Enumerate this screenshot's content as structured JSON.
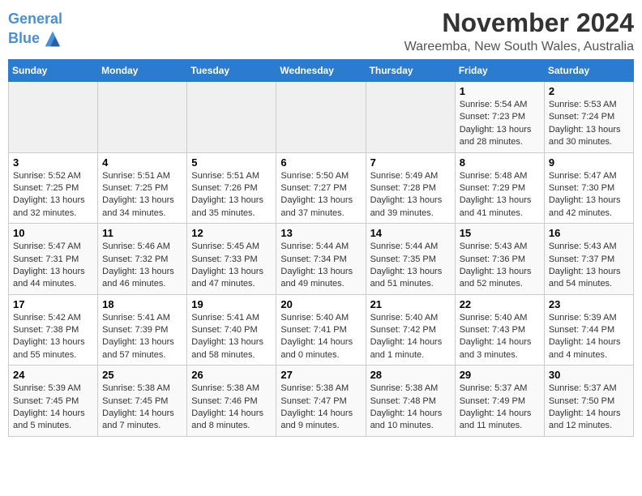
{
  "header": {
    "logo_line1": "General",
    "logo_line2": "Blue",
    "title": "November 2024",
    "subtitle": "Wareemba, New South Wales, Australia"
  },
  "days_of_week": [
    "Sunday",
    "Monday",
    "Tuesday",
    "Wednesday",
    "Thursday",
    "Friday",
    "Saturday"
  ],
  "weeks": [
    [
      {
        "day": "",
        "info": ""
      },
      {
        "day": "",
        "info": ""
      },
      {
        "day": "",
        "info": ""
      },
      {
        "day": "",
        "info": ""
      },
      {
        "day": "",
        "info": ""
      },
      {
        "day": "1",
        "info": "Sunrise: 5:54 AM\nSunset: 7:23 PM\nDaylight: 13 hours and 28 minutes."
      },
      {
        "day": "2",
        "info": "Sunrise: 5:53 AM\nSunset: 7:24 PM\nDaylight: 13 hours and 30 minutes."
      }
    ],
    [
      {
        "day": "3",
        "info": "Sunrise: 5:52 AM\nSunset: 7:25 PM\nDaylight: 13 hours and 32 minutes."
      },
      {
        "day": "4",
        "info": "Sunrise: 5:51 AM\nSunset: 7:25 PM\nDaylight: 13 hours and 34 minutes."
      },
      {
        "day": "5",
        "info": "Sunrise: 5:51 AM\nSunset: 7:26 PM\nDaylight: 13 hours and 35 minutes."
      },
      {
        "day": "6",
        "info": "Sunrise: 5:50 AM\nSunset: 7:27 PM\nDaylight: 13 hours and 37 minutes."
      },
      {
        "day": "7",
        "info": "Sunrise: 5:49 AM\nSunset: 7:28 PM\nDaylight: 13 hours and 39 minutes."
      },
      {
        "day": "8",
        "info": "Sunrise: 5:48 AM\nSunset: 7:29 PM\nDaylight: 13 hours and 41 minutes."
      },
      {
        "day": "9",
        "info": "Sunrise: 5:47 AM\nSunset: 7:30 PM\nDaylight: 13 hours and 42 minutes."
      }
    ],
    [
      {
        "day": "10",
        "info": "Sunrise: 5:47 AM\nSunset: 7:31 PM\nDaylight: 13 hours and 44 minutes."
      },
      {
        "day": "11",
        "info": "Sunrise: 5:46 AM\nSunset: 7:32 PM\nDaylight: 13 hours and 46 minutes."
      },
      {
        "day": "12",
        "info": "Sunrise: 5:45 AM\nSunset: 7:33 PM\nDaylight: 13 hours and 47 minutes."
      },
      {
        "day": "13",
        "info": "Sunrise: 5:44 AM\nSunset: 7:34 PM\nDaylight: 13 hours and 49 minutes."
      },
      {
        "day": "14",
        "info": "Sunrise: 5:44 AM\nSunset: 7:35 PM\nDaylight: 13 hours and 51 minutes."
      },
      {
        "day": "15",
        "info": "Sunrise: 5:43 AM\nSunset: 7:36 PM\nDaylight: 13 hours and 52 minutes."
      },
      {
        "day": "16",
        "info": "Sunrise: 5:43 AM\nSunset: 7:37 PM\nDaylight: 13 hours and 54 minutes."
      }
    ],
    [
      {
        "day": "17",
        "info": "Sunrise: 5:42 AM\nSunset: 7:38 PM\nDaylight: 13 hours and 55 minutes."
      },
      {
        "day": "18",
        "info": "Sunrise: 5:41 AM\nSunset: 7:39 PM\nDaylight: 13 hours and 57 minutes."
      },
      {
        "day": "19",
        "info": "Sunrise: 5:41 AM\nSunset: 7:40 PM\nDaylight: 13 hours and 58 minutes."
      },
      {
        "day": "20",
        "info": "Sunrise: 5:40 AM\nSunset: 7:41 PM\nDaylight: 14 hours and 0 minutes."
      },
      {
        "day": "21",
        "info": "Sunrise: 5:40 AM\nSunset: 7:42 PM\nDaylight: 14 hours and 1 minute."
      },
      {
        "day": "22",
        "info": "Sunrise: 5:40 AM\nSunset: 7:43 PM\nDaylight: 14 hours and 3 minutes."
      },
      {
        "day": "23",
        "info": "Sunrise: 5:39 AM\nSunset: 7:44 PM\nDaylight: 14 hours and 4 minutes."
      }
    ],
    [
      {
        "day": "24",
        "info": "Sunrise: 5:39 AM\nSunset: 7:45 PM\nDaylight: 14 hours and 5 minutes."
      },
      {
        "day": "25",
        "info": "Sunrise: 5:38 AM\nSunset: 7:45 PM\nDaylight: 14 hours and 7 minutes."
      },
      {
        "day": "26",
        "info": "Sunrise: 5:38 AM\nSunset: 7:46 PM\nDaylight: 14 hours and 8 minutes."
      },
      {
        "day": "27",
        "info": "Sunrise: 5:38 AM\nSunset: 7:47 PM\nDaylight: 14 hours and 9 minutes."
      },
      {
        "day": "28",
        "info": "Sunrise: 5:38 AM\nSunset: 7:48 PM\nDaylight: 14 hours and 10 minutes."
      },
      {
        "day": "29",
        "info": "Sunrise: 5:37 AM\nSunset: 7:49 PM\nDaylight: 14 hours and 11 minutes."
      },
      {
        "day": "30",
        "info": "Sunrise: 5:37 AM\nSunset: 7:50 PM\nDaylight: 14 hours and 12 minutes."
      }
    ]
  ]
}
